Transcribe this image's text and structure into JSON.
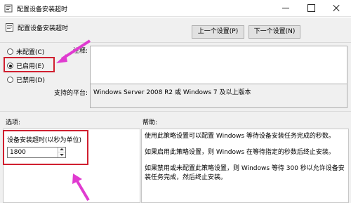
{
  "window": {
    "title": "配置设备安装超时"
  },
  "header": {
    "title": "配置设备安装超时",
    "prev_button": "上一个设置(P)",
    "next_button": "下一个设置(N)"
  },
  "state": {
    "options": [
      {
        "label": "未配置(C)",
        "checked": false
      },
      {
        "label": "已启用(E)",
        "checked": true
      },
      {
        "label": "已禁用(D)",
        "checked": false
      }
    ]
  },
  "comment": {
    "label": "注释:",
    "value": ""
  },
  "platform": {
    "label": "支持的平台:",
    "value": "Windows Server 2008 R2 或 Windows 7 及以上版本"
  },
  "options_pane": {
    "header": "选项:",
    "field_label": "设备安装超时(以秒为单位)",
    "field_value": "1800"
  },
  "help_pane": {
    "header": "帮助:",
    "paragraphs": [
      "使用此策略设置可以配置 Windows 等待设备安装任务完成的秒数。",
      "如果启用此策略设置，则 Windows 在等待指定的秒数后终止安装。",
      "如果禁用或未配置此策略设置，则 Windows 等待 300 秒以允许设备安装任务完成，然后终止安装。"
    ]
  },
  "annotations": {
    "highlight_color": "#d01f2f",
    "arrow_color": "#e03bd0"
  },
  "icons": {
    "title": "policy-icon",
    "header": "policy-icon",
    "minimize": "minimize-icon",
    "maximize": "maximize-icon",
    "close": "close-icon"
  }
}
